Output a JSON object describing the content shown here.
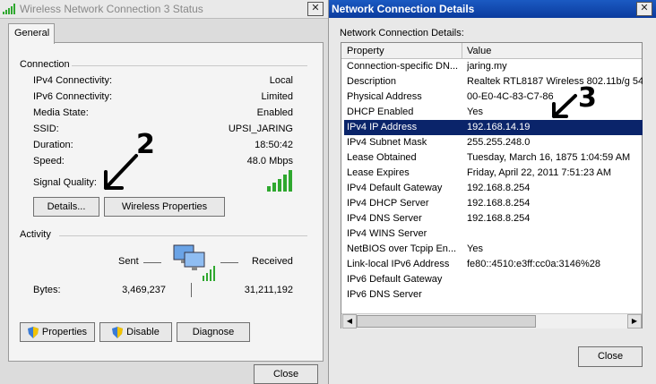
{
  "status_window": {
    "title": "Wireless Network Connection 3 Status",
    "tab_general": "General",
    "connection_heading": "Connection",
    "rows": [
      {
        "label": "IPv4 Connectivity:",
        "value": "Local"
      },
      {
        "label": "IPv6 Connectivity:",
        "value": "Limited"
      },
      {
        "label": "Media State:",
        "value": "Enabled"
      },
      {
        "label": "SSID:",
        "value": "UPSI_JARING"
      },
      {
        "label": "Duration:",
        "value": "18:50:42"
      },
      {
        "label": "Speed:",
        "value": "48.0 Mbps"
      }
    ],
    "signal_quality_label": "Signal Quality:",
    "details_button": "Details...",
    "wireless_properties_button": "Wireless Properties",
    "activity_heading": "Activity",
    "sent_label": "Sent",
    "received_label": "Received",
    "bytes_label": "Bytes:",
    "bytes_sent": "3,469,237",
    "bytes_received": "31,211,192",
    "properties_button": "Properties",
    "disable_button": "Disable",
    "diagnose_button": "Diagnose",
    "close_button": "Close",
    "annotation": "2"
  },
  "details_window": {
    "title": "Network Connection Details",
    "subtitle": "Network Connection Details:",
    "col_property": "Property",
    "col_value": "Value",
    "rows": [
      {
        "property": "Connection-specific DN...",
        "value": "jaring.my"
      },
      {
        "property": "Description",
        "value": "Realtek RTL8187 Wireless 802.11b/g 54"
      },
      {
        "property": "Physical Address",
        "value": "00-E0-4C-83-C7-86"
      },
      {
        "property": "DHCP Enabled",
        "value": "Yes"
      },
      {
        "property": "IPv4 IP Address",
        "value": "192.168.14.19"
      },
      {
        "property": "IPv4 Subnet Mask",
        "value": "255.255.248.0"
      },
      {
        "property": "Lease Obtained",
        "value": "Tuesday, March 16, 1875 1:04:59 AM"
      },
      {
        "property": "Lease Expires",
        "value": "Friday, April 22, 2011 7:51:23 AM"
      },
      {
        "property": "IPv4 Default Gateway",
        "value": "192.168.8.254"
      },
      {
        "property": "IPv4 DHCP Server",
        "value": "192.168.8.254"
      },
      {
        "property": "IPv4 DNS Server",
        "value": "192.168.8.254"
      },
      {
        "property": "IPv4 WINS Server",
        "value": ""
      },
      {
        "property": "NetBIOS over Tcpip En...",
        "value": "Yes"
      },
      {
        "property": "Link-local IPv6 Address",
        "value": "fe80::4510:e3ff:cc0a:3146%28"
      },
      {
        "property": "IPv6 Default Gateway",
        "value": ""
      },
      {
        "property": "IPv6 DNS Server",
        "value": ""
      }
    ],
    "close_button": "Close",
    "annotation": "3"
  },
  "colors": {
    "selection": "#0a246a",
    "signal_green": "#2fa82f"
  }
}
